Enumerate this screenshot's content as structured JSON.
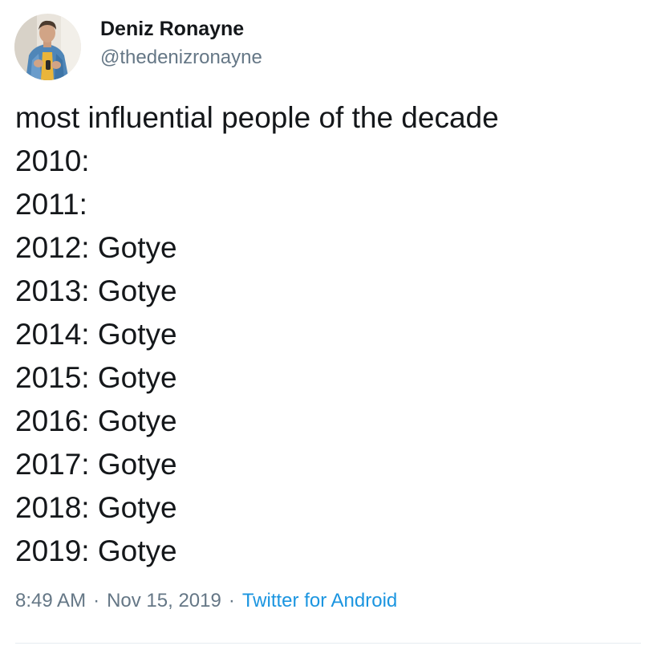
{
  "author": {
    "name": "Deniz Ronayne",
    "handle": "@thedenizronayne",
    "avatar_icon": "profile-photo-avatar"
  },
  "tweet": {
    "lines": [
      "most influential people of the decade",
      "2010:",
      "2011:",
      "2012: Gotye",
      "2013: Gotye",
      "2014: Gotye",
      "2015: Gotye",
      "2016: Gotye",
      "2017: Gotye",
      "2018: Gotye",
      "2019: Gotye"
    ]
  },
  "meta": {
    "time": "8:49 AM",
    "separator": "·",
    "date": "Nov 15, 2019",
    "source": "Twitter for Android"
  },
  "colors": {
    "text": "#14171a",
    "secondary": "#657786",
    "link": "#1b95e0",
    "divider": "#e6ecf0"
  }
}
